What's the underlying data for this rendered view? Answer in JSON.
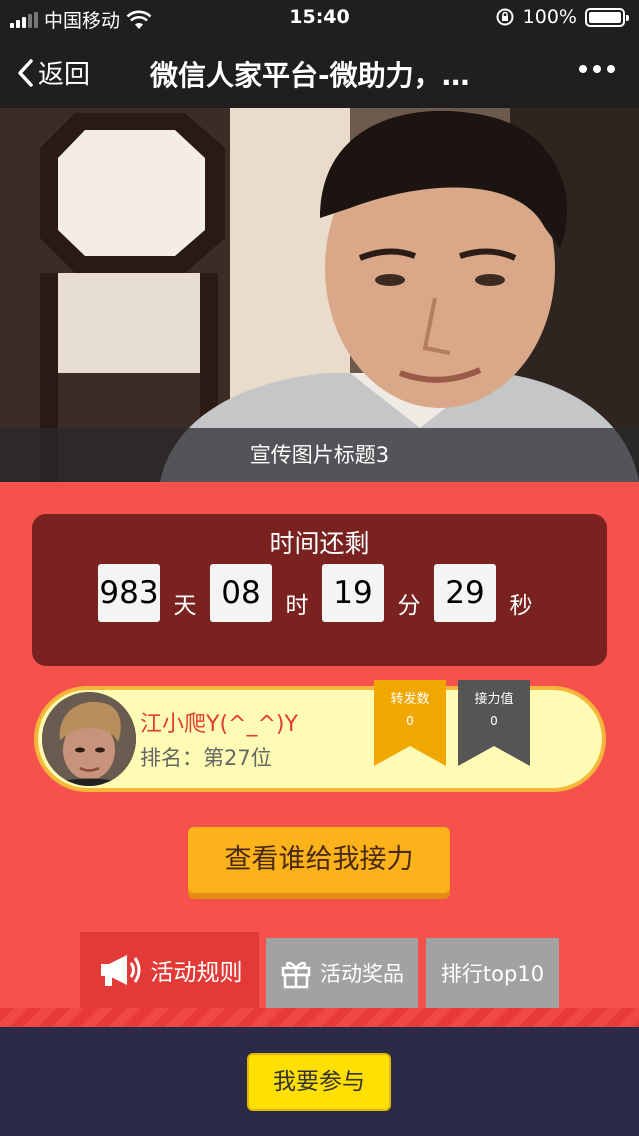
{
  "status_bar": {
    "carrier": "中国移动",
    "time": "15:40",
    "battery": "100%"
  },
  "nav": {
    "back_label": "返回",
    "title": "微信人家平台-微助力，…"
  },
  "hero": {
    "caption": "宣传图片标题3"
  },
  "countdown": {
    "title": "时间还剩",
    "days": "983",
    "days_unit": "天",
    "hours": "08",
    "hours_unit": "时",
    "minutes": "19",
    "minutes_unit": "分",
    "seconds": "29",
    "seconds_unit": "秒"
  },
  "user": {
    "name": "江小爬Y(^_^)Y",
    "rank_label": "排名：",
    "rank_value": "第27位",
    "forward": {
      "label": "转发数",
      "value": "0"
    },
    "relay": {
      "label": "接力值",
      "value": "0"
    }
  },
  "actions": {
    "who_helped": "查看谁给我接力",
    "join": "我要参与"
  },
  "tabs": {
    "rules": "活动规则",
    "prizes": "活动奖品",
    "top10": "排行top10"
  },
  "colors": {
    "accent_red": "#f5524e",
    "dark_red": "#7a2220",
    "gold": "#fbb21b",
    "badge_gold": "#f0a800",
    "badge_gray": "#555555"
  },
  "icons": [
    "signal-icon",
    "wifi-icon",
    "rotation-lock-icon",
    "battery-icon",
    "back-chevron-icon",
    "more-icon",
    "megaphone-icon",
    "gift-icon"
  ]
}
